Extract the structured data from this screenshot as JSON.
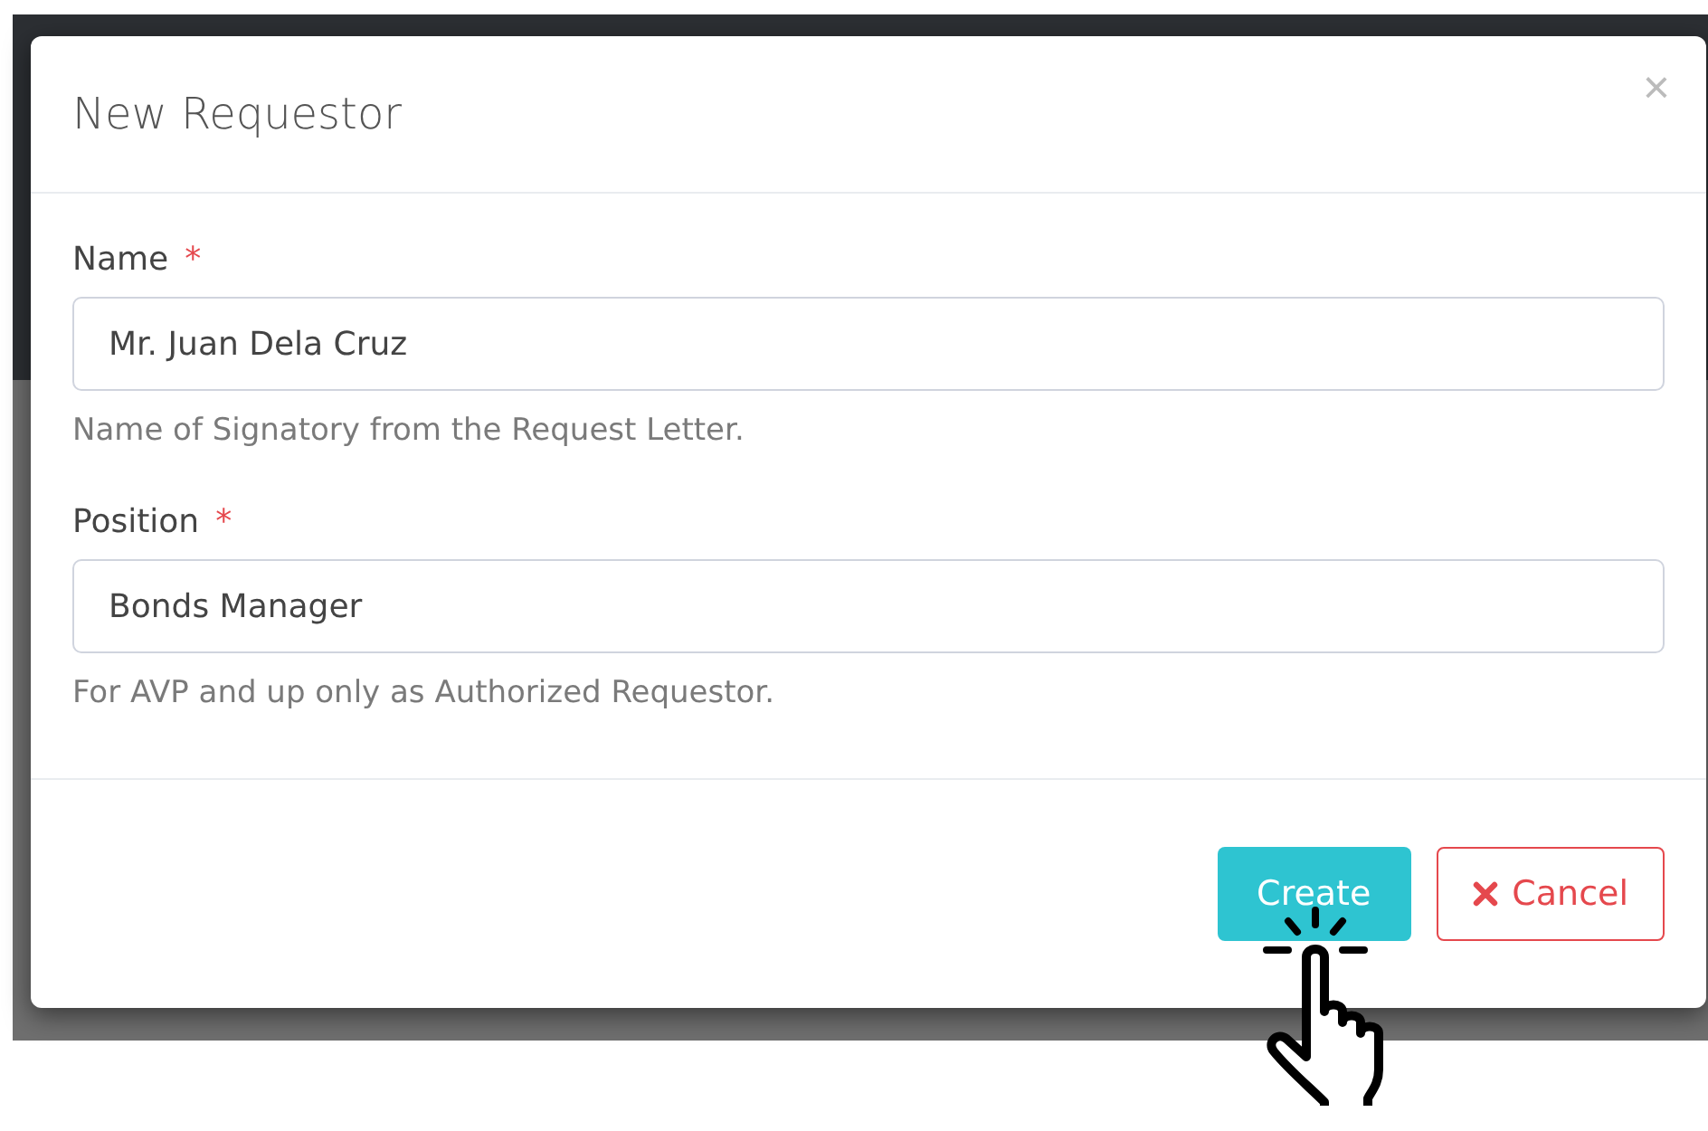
{
  "dialog": {
    "title": "New Requestor",
    "close": "×",
    "fields": [
      {
        "label": "Name",
        "required_mark": "*",
        "value": "Mr. Juan Dela Cruz",
        "help": "Name of Signatory from the Request Letter."
      },
      {
        "label": "Position",
        "required_mark": "*",
        "value": "Bonds Manager",
        "help": "For AVP and up only as Authorized Requestor."
      }
    ],
    "buttons": [
      {
        "kind": "primary",
        "label": "Create"
      },
      {
        "kind": "cancel",
        "label": "Cancel"
      }
    ]
  }
}
